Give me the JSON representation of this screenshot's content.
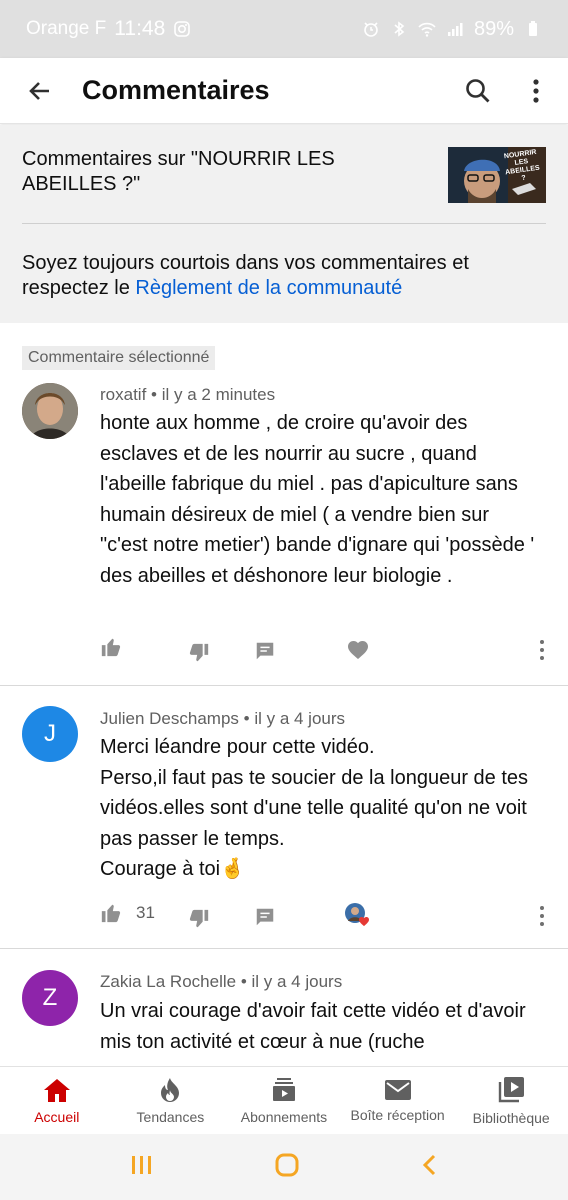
{
  "status_bar": {
    "carrier": "Orange F",
    "time": "11:48",
    "battery": "89%",
    "icons": [
      "instagram-icon",
      "alarm-icon",
      "bluetooth-icon",
      "wifi-icon",
      "signal-icon",
      "battery-icon"
    ]
  },
  "header": {
    "title": "Commentaires",
    "icons": [
      "back-arrow-icon",
      "search-icon",
      "more-vert-icon"
    ]
  },
  "info": {
    "video_title": "Commentaires sur \"NOURRIR LES ABEILLES ?\"",
    "thumbnail_text": "NOURRIR LES ABEILLES ?",
    "policy_text": "Soyez toujours courtois dans vos commentaires et respectez le ",
    "policy_link": "Règlement de la communauté"
  },
  "selected_label": "Commentaire sélectionné",
  "comments": [
    {
      "author": "roxatif",
      "time": "il y a 2 minutes",
      "separator": "•",
      "text": "honte aux homme , de croire qu'avoir des esclaves et de les nourrir au sucre , quand l'abeille fabrique du miel . pas d'apiculture sans humain désireux de miel ( a vendre bien sur \"c'est notre metier') bande d'ignare qui 'possède ' des abeilles et déshonore leur biologie .",
      "likes": "",
      "avatar_color": "#6b4a3a"
    },
    {
      "author": "Julien Deschamps",
      "time": "il y a 4 jours",
      "separator": "•",
      "text_lines": [
        "Merci léandre pour cette vidéo.",
        "Perso,il faut pas te soucier de la longueur de tes vidéos.elles sont d'une telle qualité qu'on ne voit pas passer le temps.",
        "Courage à toi🤞"
      ],
      "likes": "31",
      "avatar_letter": "J",
      "avatar_color": "#1e88e5"
    },
    {
      "author": "Zakia La Rochelle",
      "time": "il y a 4 jours",
      "separator": "•",
      "text": "Un vrai courage d'avoir fait cette vidéo et d'avoir mis ton activité et cœur à nue (ruche",
      "avatar_letter": "Z",
      "avatar_color": "#8e24aa"
    }
  ],
  "bottom_nav": [
    {
      "label": "Accueil",
      "icon": "home-icon",
      "active": true
    },
    {
      "label": "Tendances",
      "icon": "flame-icon",
      "active": false
    },
    {
      "label": "Abonnements",
      "icon": "subscriptions-icon",
      "active": false
    },
    {
      "label": "Boîte réception",
      "icon": "mail-icon",
      "active": false
    },
    {
      "label": "Bibliothèque",
      "icon": "library-icon",
      "active": false
    }
  ],
  "colors": {
    "accent_red": "#cc0000",
    "link_blue": "#065fd4",
    "system_nav_orange": "#f5a623"
  }
}
